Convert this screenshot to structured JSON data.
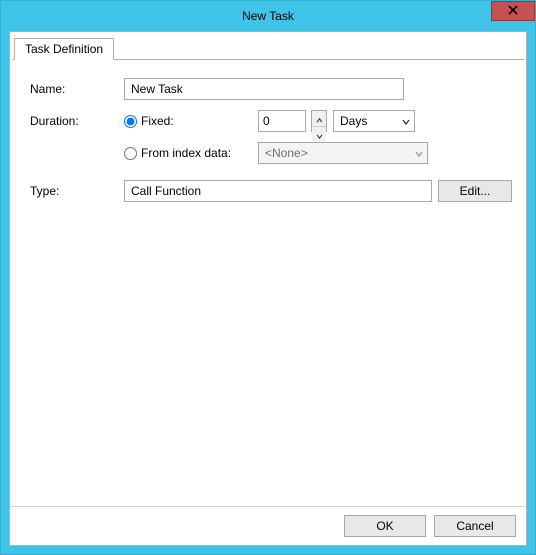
{
  "window": {
    "title": "New Task"
  },
  "tabs": {
    "definition": "Task Definition"
  },
  "form": {
    "name_label": "Name:",
    "name_value": "New Task",
    "duration_label": "Duration:",
    "fixed_label": "Fixed:",
    "fixed_value": "0",
    "unit_selected": "Days",
    "from_index_label": "From index data:",
    "index_selected": "<None>",
    "type_label": "Type:",
    "type_value": "Call Function",
    "edit_label": "Edit..."
  },
  "footer": {
    "ok": "OK",
    "cancel": "Cancel"
  }
}
